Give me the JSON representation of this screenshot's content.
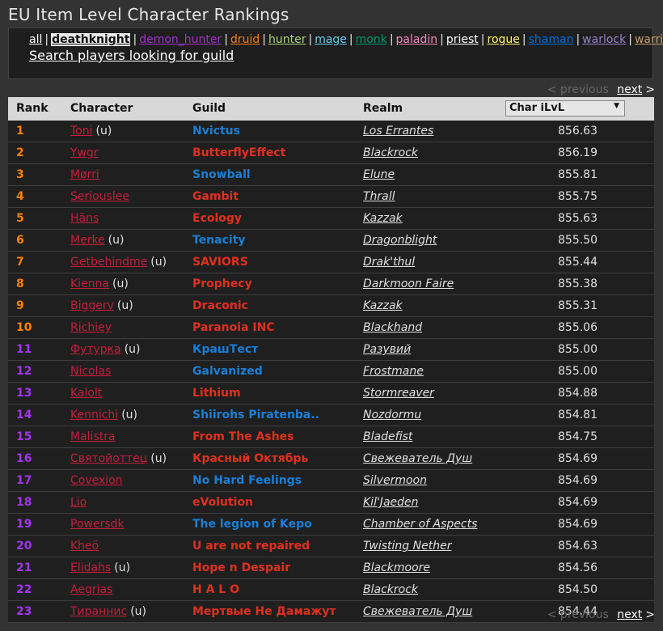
{
  "page_title": "EU Item Level Character Rankings",
  "classes": [
    {
      "label": "all",
      "color": "#ffffff",
      "active": false
    },
    {
      "label": "deathknight",
      "color": "#111111",
      "active": true
    },
    {
      "label": "demon_hunter",
      "color": "#a330c9",
      "active": false
    },
    {
      "label": "druid",
      "color": "#ff7d0a",
      "active": false
    },
    {
      "label": "hunter",
      "color": "#abd473",
      "active": false
    },
    {
      "label": "mage",
      "color": "#69ccf0",
      "active": false
    },
    {
      "label": "monk",
      "color": "#00996a",
      "active": false
    },
    {
      "label": "paladin",
      "color": "#f58cba",
      "active": false
    },
    {
      "label": "priest",
      "color": "#ffffff",
      "active": false
    },
    {
      "label": "rogue",
      "color": "#fff569",
      "active": false
    },
    {
      "label": "shaman",
      "color": "#0070de",
      "active": false
    },
    {
      "label": "warlock",
      "color": "#9482c9",
      "active": false
    },
    {
      "label": "warrior",
      "color": "#c79c6e",
      "active": false
    }
  ],
  "search_link": "Search players looking for guild",
  "pager": {
    "previous": "< previous",
    "next": "next",
    "next_arrow": ">"
  },
  "table": {
    "headers": {
      "rank": "Rank",
      "character": "Character",
      "guild": "Guild",
      "realm": "Realm"
    },
    "sort_select": "Char iLvL",
    "rank_colors": {
      "legendary": "#ff8000",
      "epic": "#a335ee"
    },
    "rows": [
      {
        "rank": "1",
        "character": "Toni",
        "u": "(u)",
        "guild": "Nvictus",
        "faction": "alliance",
        "realm": "Los Errantes",
        "ilvl": "856.63"
      },
      {
        "rank": "2",
        "character": "Ywgr",
        "u": "",
        "guild": "ButterflyEffect",
        "faction": "horde",
        "realm": "Blackrock",
        "ilvl": "856.19"
      },
      {
        "rank": "3",
        "character": "Mørri",
        "u": "",
        "guild": "Snowball",
        "faction": "alliance",
        "realm": "Elune",
        "ilvl": "855.81"
      },
      {
        "rank": "4",
        "character": "Seriouslee",
        "u": "",
        "guild": "Gambit",
        "faction": "horde",
        "realm": "Thrall",
        "ilvl": "855.75"
      },
      {
        "rank": "5",
        "character": "Hãns",
        "u": "",
        "guild": "Ecology",
        "faction": "horde",
        "realm": "Kazzak",
        "ilvl": "855.63"
      },
      {
        "rank": "6",
        "character": "Merke",
        "u": "(u)",
        "guild": "Tenacity",
        "faction": "alliance",
        "realm": "Dragonblight",
        "ilvl": "855.50"
      },
      {
        "rank": "7",
        "character": "Getbehindme",
        "u": "(u)",
        "guild": "SAVIORS",
        "faction": "horde",
        "realm": "Drak'thul",
        "ilvl": "855.44"
      },
      {
        "rank": "8",
        "character": "Kienna",
        "u": "(u)",
        "guild": "Prophecy",
        "faction": "horde",
        "realm": "Darkmoon Faire",
        "ilvl": "855.38"
      },
      {
        "rank": "9",
        "character": "Biggerv",
        "u": "(u)",
        "guild": "Draconic",
        "faction": "horde",
        "realm": "Kazzak",
        "ilvl": "855.31"
      },
      {
        "rank": "10",
        "character": "Richiey",
        "u": "",
        "guild": "Paranoia INC",
        "faction": "horde",
        "realm": "Blackhand",
        "ilvl": "855.06"
      },
      {
        "rank": "11",
        "character": "Футурка",
        "u": "(u)",
        "guild": "КрашТест",
        "faction": "alliance",
        "realm": "Разувий",
        "ilvl": "855.00"
      },
      {
        "rank": "12",
        "character": "Nicolas",
        "u": "",
        "guild": "Galvanized",
        "faction": "alliance",
        "realm": "Frostmane",
        "ilvl": "855.00"
      },
      {
        "rank": "13",
        "character": "Kalolt",
        "u": "",
        "guild": "Lithium",
        "faction": "horde",
        "realm": "Stormreaver",
        "ilvl": "854.88"
      },
      {
        "rank": "14",
        "character": "Kennichi",
        "u": "(u)",
        "guild": "Shiirohs Piratenba..",
        "faction": "alliance",
        "realm": "Nozdormu",
        "ilvl": "854.81"
      },
      {
        "rank": "15",
        "character": "Malistra",
        "u": "",
        "guild": "From The Ashes",
        "faction": "horde",
        "realm": "Bladefist",
        "ilvl": "854.75"
      },
      {
        "rank": "16",
        "character": "Святойоттец",
        "u": "(u)",
        "guild": "Красный Октябрь",
        "faction": "horde",
        "realm": "Свежеватель Душ",
        "ilvl": "854.69"
      },
      {
        "rank": "17",
        "character": "Covexion",
        "u": "",
        "guild": "No Hard Feelings",
        "faction": "alliance",
        "realm": "Silvermoon",
        "ilvl": "854.69"
      },
      {
        "rank": "18",
        "character": "Lio",
        "u": "",
        "guild": "eVolution",
        "faction": "horde",
        "realm": "Kil'Jaeden",
        "ilvl": "854.69"
      },
      {
        "rank": "19",
        "character": "Powersdk",
        "u": "",
        "guild": "The legion of Kepo",
        "faction": "alliance",
        "realm": "Chamber of Aspects",
        "ilvl": "854.69"
      },
      {
        "rank": "20",
        "character": "Kheö",
        "u": "",
        "guild": "U are not repaired",
        "faction": "horde",
        "realm": "Twisting Nether",
        "ilvl": "854.63"
      },
      {
        "rank": "21",
        "character": "Elidahs",
        "u": "(u)",
        "guild": "Hope n Despair",
        "faction": "horde",
        "realm": "Blackmoore",
        "ilvl": "854.56"
      },
      {
        "rank": "22",
        "character": "Aegrias",
        "u": "",
        "guild": "H A L O",
        "faction": "horde",
        "realm": "Blackrock",
        "ilvl": "854.50"
      },
      {
        "rank": "23",
        "character": "Тираннис",
        "u": "(u)",
        "guild": "Мертвые Не Дамажут",
        "faction": "horde",
        "realm": "Свежеватель Душ",
        "ilvl": "854.44"
      }
    ]
  },
  "faction_colors": {
    "alliance": "#1a7fd6",
    "horde": "#e0301e"
  }
}
